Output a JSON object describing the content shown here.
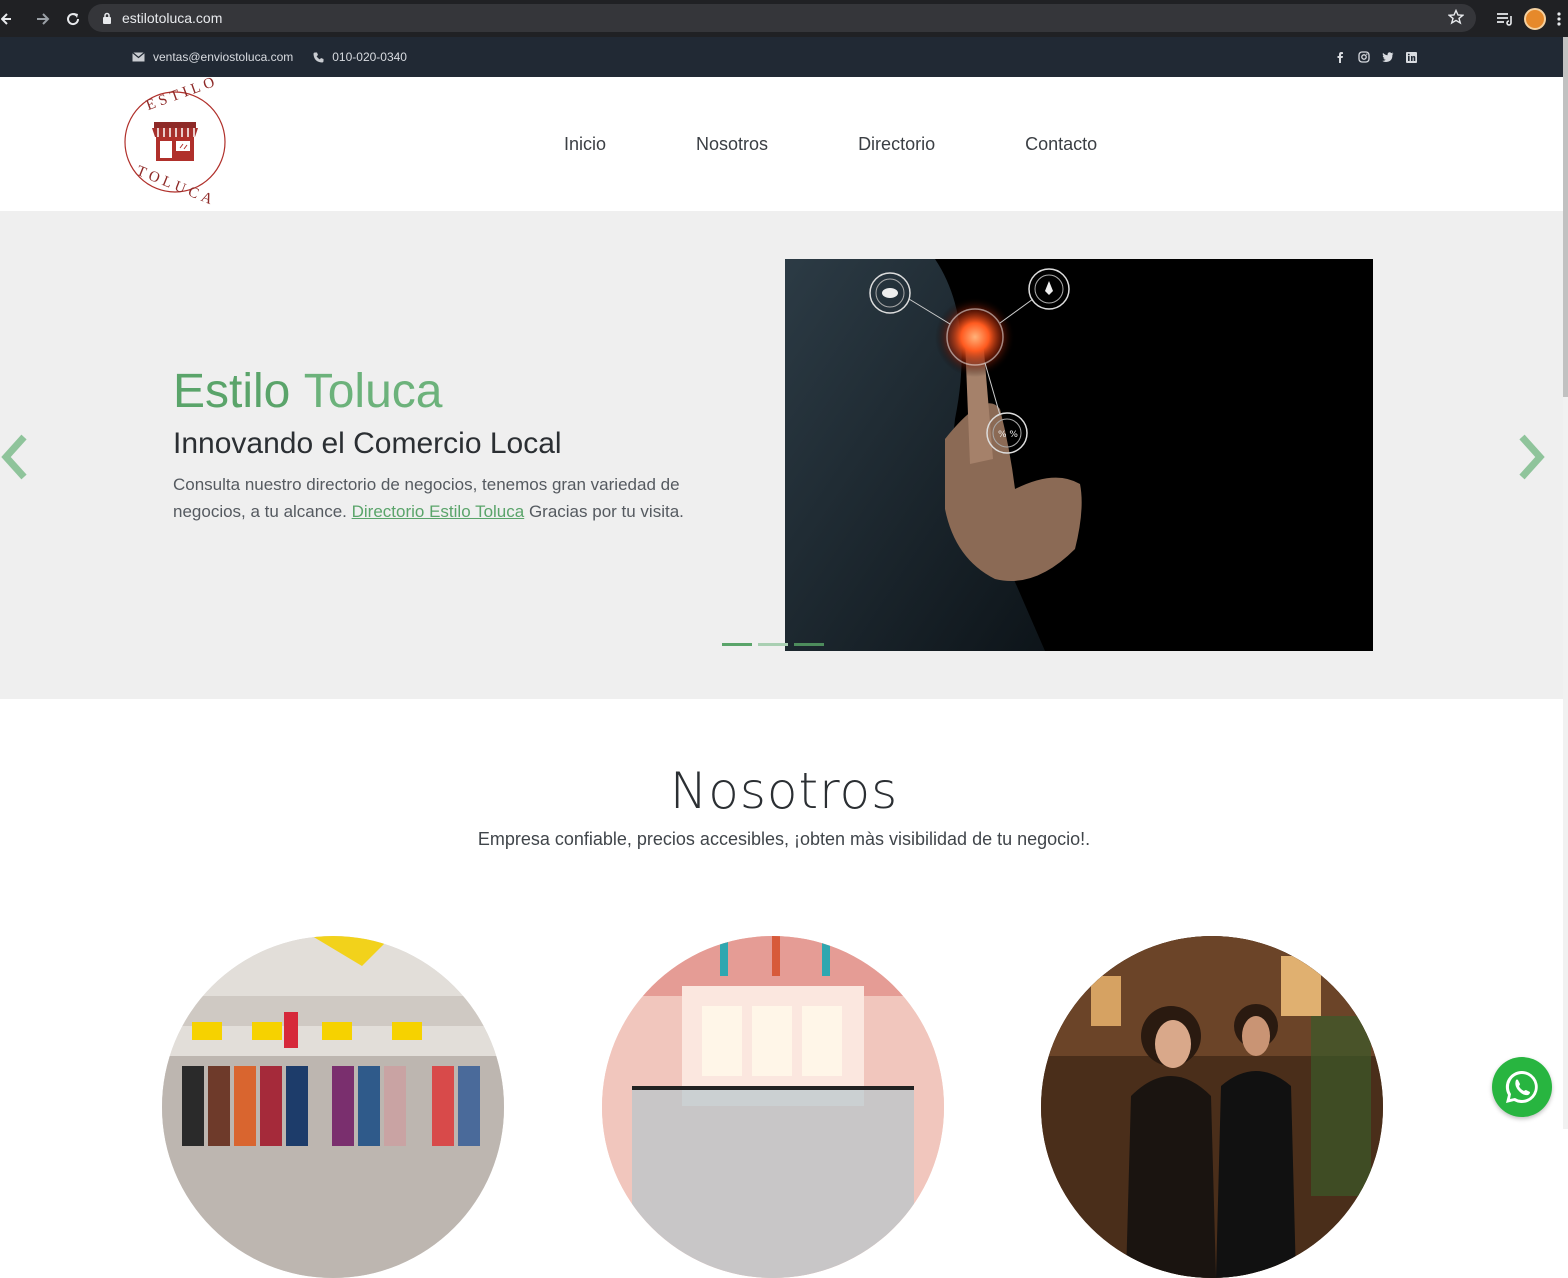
{
  "browser": {
    "url": "estilotoluca.com"
  },
  "topbar": {
    "email": "ventas@enviostoluca.com",
    "phone": "010-020-0340",
    "social": [
      "facebook-icon",
      "instagram-icon",
      "twitter-icon",
      "linkedin-icon"
    ]
  },
  "header": {
    "logo": {
      "top_text": "ESTILO",
      "bottom_text": "TOLUCA"
    },
    "menu": [
      {
        "label": "Inicio"
      },
      {
        "label": "Nosotros"
      },
      {
        "label": "Directorio"
      },
      {
        "label": "Contacto"
      }
    ]
  },
  "hero": {
    "title_bold": "Estilo",
    "title_light": "Toluca",
    "subtitle": "Innovando el Comercio Local",
    "desc_before": "Consulta nuestro directorio de negocios, tenemos gran variedad de negocios, a tu alcance. ",
    "desc_link": "Directorio Estilo Toluca",
    "desc_after": " Gracias por tu visita.",
    "slides": 3,
    "active_slide": 1
  },
  "nosotros": {
    "title": "Nosotros",
    "subtitle": "Empresa confiable, precios accesibles, ¡obten màs visibilidad de tu negocio!."
  },
  "colors": {
    "accent": "#5aa46a",
    "topbar": "#212934",
    "hero_bg": "#efefef",
    "whatsapp": "#28b540"
  }
}
